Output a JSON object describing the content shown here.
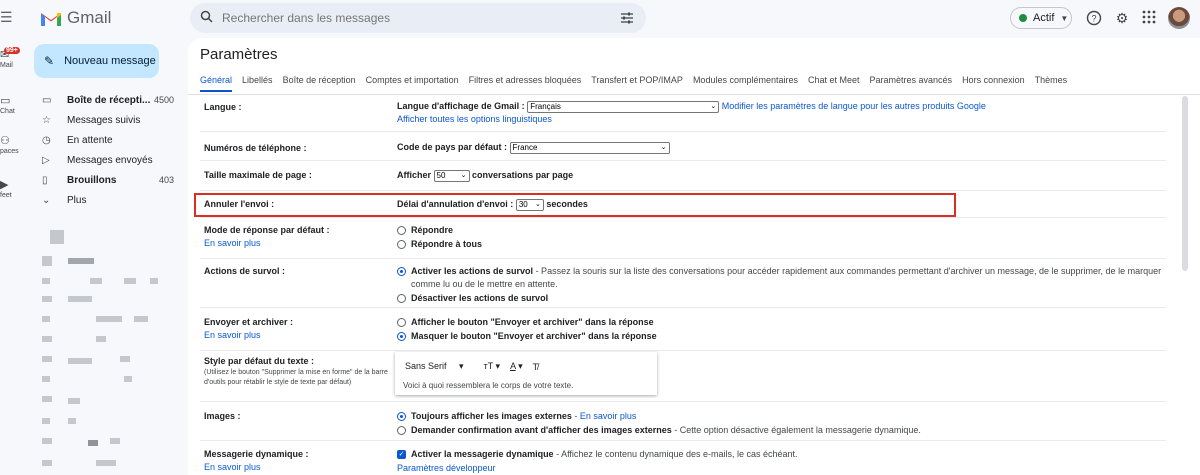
{
  "app": {
    "name": "Gmail"
  },
  "colors": {
    "accent": "#0b57d0",
    "highlight": "#d93025",
    "compose_bg": "#c2e7ff",
    "status_green": "#1e8e3e"
  },
  "top": {
    "search_placeholder": "Rechercher dans les messages",
    "status_label": "Actif",
    "icons": [
      "menu-icon",
      "search-icon",
      "tune-icon",
      "help-icon",
      "settings-icon",
      "apps-icon"
    ]
  },
  "rail": {
    "badge": "99+",
    "items": [
      {
        "label": "Mail",
        "icon": "mail-icon"
      },
      {
        "label": "Chat",
        "icon": "chat-icon"
      },
      {
        "label": "Spaces",
        "display": "paces",
        "icon": "spaces-icon"
      },
      {
        "label": "Meet",
        "display": "feet",
        "icon": "meet-icon"
      }
    ]
  },
  "compose": {
    "label": "Nouveau message"
  },
  "nav": {
    "items": [
      {
        "label": "Boîte de récepti...",
        "count": "4500",
        "icon": "inbox-icon",
        "bold": true
      },
      {
        "label": "Messages suivis",
        "count": "",
        "icon": "star-icon",
        "bold": false
      },
      {
        "label": "En attente",
        "count": "",
        "icon": "clock-icon",
        "bold": false
      },
      {
        "label": "Messages envoyés",
        "count": "",
        "icon": "send-icon",
        "bold": false
      },
      {
        "label": "Brouillons",
        "count": "403",
        "icon": "draft-icon",
        "bold": true
      },
      {
        "label": "Plus",
        "count": "",
        "icon": "chevron-down-icon",
        "bold": false
      }
    ]
  },
  "settings": {
    "title": "Paramètres",
    "tabs": [
      "Général",
      "Libellés",
      "Boîte de réception",
      "Comptes et importation",
      "Filtres et adresses bloquées",
      "Transfert et POP/IMAP",
      "Modules complémentaires",
      "Chat et Meet",
      "Paramètres avancés",
      "Hors connexion",
      "Thèmes"
    ],
    "active_tab": "Général",
    "language": {
      "label": "Langue :",
      "display_label": "Langue d'affichage de Gmail :",
      "value": "Français",
      "link1": "Modifier les paramètres de langue pour les autres produits Google",
      "link2": "Afficher toutes les options linguistiques"
    },
    "phone": {
      "label": "Numéros de téléphone :",
      "country_label": "Code de pays par défaut :",
      "value": "France"
    },
    "page_size": {
      "label": "Taille maximale de page :",
      "prefix": "Afficher",
      "value": "50",
      "suffix": "conversations par page"
    },
    "undo_send": {
      "label": "Annuler l'envoi :",
      "delay_label": "Délai d'annulation d'envoi :",
      "value": "30",
      "suffix": "secondes"
    },
    "reply": {
      "label": "Mode de réponse par défaut :",
      "link": "En savoir plus",
      "options": [
        "Répondre",
        "Répondre à tous"
      ],
      "selected": "Répondre"
    },
    "hover": {
      "label": "Actions de survol :",
      "options": [
        {
          "title": "Activer les actions de survol",
          "desc": " - Passez la souris sur la liste des conversations pour accéder rapidement aux commandes permettant d'archiver un message, de le supprimer, de le marquer comme lu ou de le mettre en attente."
        },
        {
          "title": "Désactiver les actions de survol",
          "desc": ""
        }
      ],
      "selected": "Activer les actions de survol"
    },
    "send_archive": {
      "label": "Envoyer et archiver :",
      "link": "En savoir plus",
      "options": [
        "Afficher le bouton \"Envoyer et archiver\" dans la réponse",
        "Masquer le bouton \"Envoyer et archiver\" dans la réponse"
      ],
      "selected": "Masquer le bouton \"Envoyer et archiver\" dans la réponse"
    },
    "text_style": {
      "label": "Style par défaut du texte :",
      "hint": "(Utilisez le bouton \"Supprimer la mise en forme\" de la barre d'outils pour rétablir le style de texte par défaut)",
      "font": "Sans Serif",
      "preview": "Voici à quoi ressemblera le corps de votre texte."
    },
    "images": {
      "label": "Images :",
      "options": [
        {
          "title": "Toujours afficher les images externes",
          "desc": " - ",
          "link": "En savoir plus"
        },
        {
          "title": "Demander confirmation avant d'afficher des images externes",
          "desc": " - Cette option désactive également la messagerie dynamique."
        }
      ],
      "selected": "Toujours afficher les images externes"
    },
    "dynamic": {
      "label": "Messagerie dynamique :",
      "link": "En savoir plus",
      "check_title": "Activer la messagerie dynamique",
      "check_desc": " - Affichez le contenu dynamique des e-mails, le cas échéant.",
      "dev_link": "Paramètres développeur",
      "checked": true
    }
  }
}
